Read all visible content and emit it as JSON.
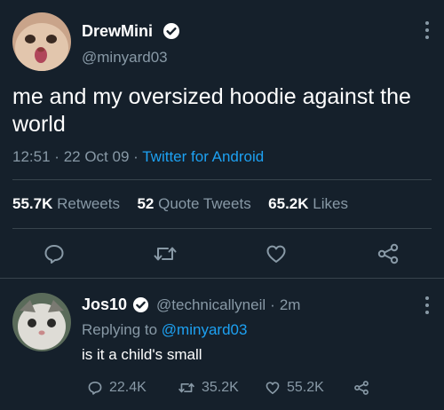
{
  "tweet": {
    "author": {
      "display_name": "DrewMini",
      "handle": "@minyard03",
      "verified": true
    },
    "text": "me and my oversized hoodie against the world",
    "time": "12:51",
    "separator": "·",
    "date": "22 Oct 09",
    "client": "Twitter for Android",
    "stats": {
      "retweets_count": "55.7K",
      "retweets_label": "Retweets",
      "quotes_count": "52",
      "quotes_label": "Quote Tweets",
      "likes_count": "65.2K",
      "likes_label": "Likes"
    }
  },
  "reply": {
    "author": {
      "display_name": "Jos10",
      "handle": "@technicallyneil",
      "verified": true
    },
    "time_ago": "2m",
    "replying_to_label": "Replying to",
    "replying_to_handle": "@minyard03",
    "text": "is it a child's small",
    "actions": {
      "replies": "22.4K",
      "retweets": "35.2K",
      "likes": "55.2K"
    }
  },
  "colors": {
    "background": "#15202b",
    "text": "#ffffff",
    "muted": "#8899a6",
    "accent": "#1da1f2",
    "divider": "#38444d"
  },
  "icons": [
    "verified-badge-icon",
    "more-icon",
    "reply-icon",
    "retweet-icon",
    "like-icon",
    "share-icon"
  ]
}
